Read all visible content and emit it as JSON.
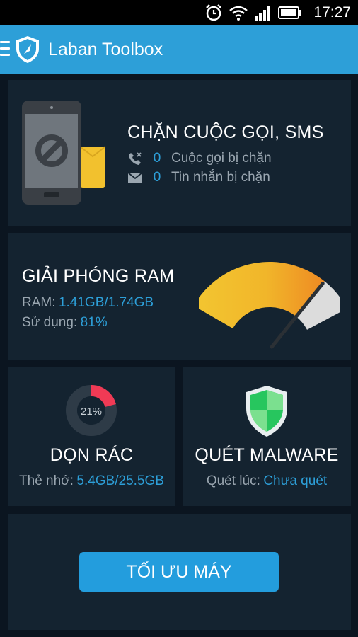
{
  "status_bar": {
    "time": "17:27",
    "icons": [
      "alarm-icon",
      "wifi-icon",
      "signal-icon",
      "battery-icon"
    ]
  },
  "app_bar": {
    "title": "Laban Toolbox",
    "icons": [
      "menu-icon",
      "shield-logo-icon"
    ]
  },
  "block_card": {
    "title": "CHẶN CUỘC GỌI, SMS",
    "calls_count": "0",
    "calls_label": "Cuộc gọi bị chặn",
    "sms_count": "0",
    "sms_label": "Tin nhắn bị chặn",
    "icons": [
      "phone-blocked-icon",
      "blocked-call-icon",
      "mail-icon"
    ]
  },
  "ram_card": {
    "title": "GIẢI PHÓNG RAM",
    "ram_label": "RAM:",
    "ram_value": "1.41GB/1.74GB",
    "usage_label": "Sử dụng:",
    "usage_value": "81%",
    "usage_fraction": 0.81
  },
  "junk_card": {
    "title": "DỌN RÁC",
    "percent_text": "21%",
    "percent": 21,
    "storage_label": "Thẻ nhớ:",
    "storage_value": "5.4GB/25.5GB"
  },
  "malware_card": {
    "title": "QUÉT MALWARE",
    "scan_label": "Quét lúc:",
    "scan_value": "Chưa quét",
    "icons": [
      "shield-icon"
    ]
  },
  "optimize": {
    "button_label": "TỐI ƯU MÁY"
  },
  "colors": {
    "app_bar": "#2d9fd8",
    "background": "#0b1520",
    "card": "#142330",
    "accent": "#2d9fd8",
    "gauge_yellow": "#f3c631",
    "gauge_orange": "#ee8a23",
    "donut_red": "#f03a55",
    "shield_green": "#27c65e"
  }
}
